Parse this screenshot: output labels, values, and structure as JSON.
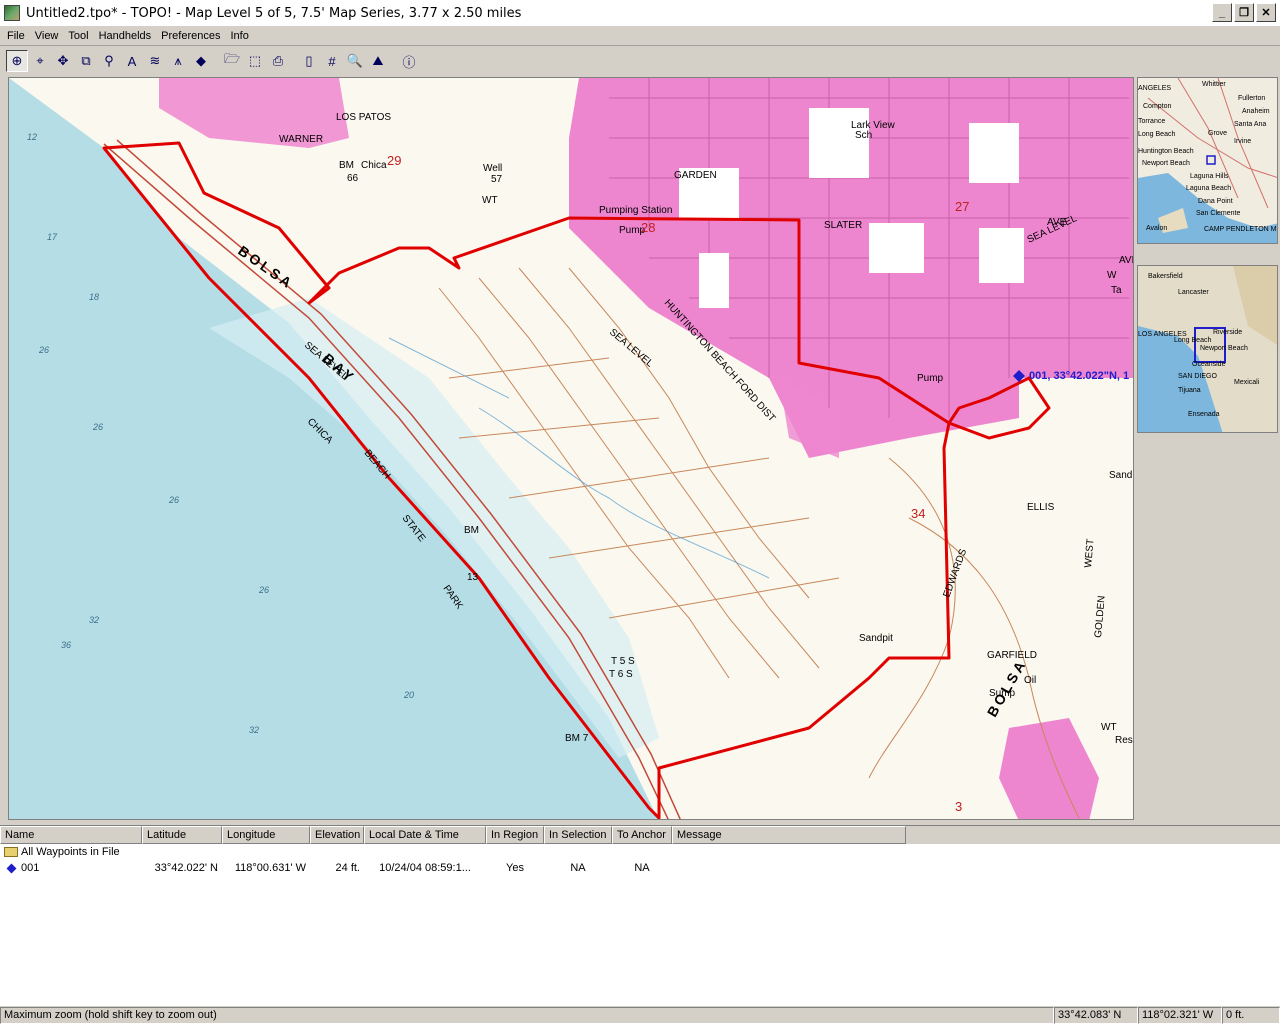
{
  "window": {
    "title": "Untitled2.tpo* - TOPO! - Map Level 5 of 5, 7.5' Map Series, 3.77 x 2.50 miles",
    "buttons": [
      "_",
      "❐",
      "✕"
    ]
  },
  "menu": [
    "File",
    "View",
    "Tool",
    "Handhelds",
    "Preferences",
    "Info"
  ],
  "toolbar": {
    "tools": [
      {
        "name": "zoom-tool-icon",
        "glyph": "⊕",
        "active": true
      },
      {
        "name": "center-tool-icon",
        "glyph": "⌖",
        "active": false
      },
      {
        "name": "pan-tool-icon",
        "glyph": "✥",
        "active": false
      },
      {
        "name": "copy-map-icon",
        "glyph": "⧉",
        "active": false
      },
      {
        "name": "pushpin-tool-icon",
        "glyph": "⚲",
        "active": false
      },
      {
        "name": "text-tool-icon",
        "glyph": "A",
        "active": false
      },
      {
        "name": "route-tool-icon",
        "glyph": "≋",
        "active": false
      },
      {
        "name": "north-arrow-icon",
        "glyph": "⩚",
        "active": false
      },
      {
        "name": "waypoint-tool-icon",
        "glyph": "◆",
        "active": false
      },
      {
        "name": "open-file-icon",
        "glyph": "🗁",
        "active": false
      },
      {
        "name": "select-area-icon",
        "glyph": "⬚",
        "active": false
      },
      {
        "name": "print-icon",
        "glyph": "⎙",
        "active": false
      },
      {
        "name": "handheld-icon",
        "glyph": "▯",
        "active": false
      },
      {
        "name": "grid-icon",
        "glyph": "#",
        "active": false
      },
      {
        "name": "search-icon",
        "glyph": "🔍",
        "active": false
      },
      {
        "name": "elevation-profile-icon",
        "glyph": "⛰",
        "active": false
      },
      {
        "name": "info-icon",
        "glyph": "ⓘ",
        "active": false
      }
    ]
  },
  "map": {
    "labels": [
      "Lark View",
      "Sch",
      "Pumping Station",
      "Pump",
      "Pump",
      "SLATER",
      "AVE",
      "AVE",
      "GARDEN",
      "WARNER",
      "LOS PATOS",
      "Chica",
      "BM",
      "66",
      "Well",
      "57",
      "WT",
      "29",
      "28",
      "27",
      "34",
      "3",
      "BOLSA",
      "BAY",
      "BOLSA",
      "CHICA",
      "BEACH",
      "STATE",
      "PARK",
      "HUNTINGTON BEACH FORD DIST",
      "SEA LEVEL",
      "SEA LEVEL",
      "SEA LEVEL",
      "EDWARDS",
      "ELLIS",
      "GARFIELD",
      "GOLDEN",
      "WEST",
      "Sandpit",
      "Oil",
      "Sump",
      "BM",
      "13",
      "BM 7",
      "T 5 S",
      "T 6 S",
      "12",
      "17",
      "18",
      "26",
      "26",
      "26",
      "26",
      "32",
      "32",
      "36",
      "20",
      "Sand",
      "Res",
      "WT",
      "Ta",
      "W"
    ],
    "waypoint_label": "001, 33°42.022\"N, 1"
  },
  "overview_top": {
    "labels": [
      "ANGELES",
      "Compton",
      "Torrance",
      "Long Beach",
      "Huntington Beach",
      "Newport Beach",
      "Laguna Hills",
      "Laguna Beach",
      "Dana Point",
      "San Clemente",
      "Fullerton",
      "Anaheim",
      "Santa Ana",
      "Grove",
      "Irvine",
      "Avalon",
      "CAMP PENDLETON M",
      "Whittier"
    ]
  },
  "overview_bottom": {
    "labels": [
      "Bakersfield",
      "Lancaster",
      "LOS ANGELES",
      "Long Beach",
      "Riverside",
      "Newport Beach",
      "SAN DIEGO",
      "Oceanside",
      "Tijuana",
      "Ensenada",
      "Mexicali"
    ]
  },
  "grid": {
    "columns": [
      "Name",
      "Latitude",
      "Longitude",
      "Elevation",
      "Local Date & Time",
      "In Region",
      "In Selection",
      "To Anchor",
      "Message"
    ],
    "folder": "All Waypoints in File",
    "rows": [
      {
        "name": "001",
        "latitude": "33°42.022' N",
        "longitude": "118°00.631' W",
        "elevation": "24 ft.",
        "datetime": "10/24/04 08:59:1...",
        "in_region": "Yes",
        "in_selection": "NA",
        "to_anchor": "NA",
        "message": ""
      }
    ]
  },
  "status": {
    "message": "Maximum zoom (hold shift key to zoom out)",
    "latitude": "33°42.083' N",
    "longitude": "118°02.321' W",
    "elevation": "0 ft."
  },
  "colors": {
    "ocean": "#b5dde6",
    "urban": "#ee86cf",
    "route": "#e00000",
    "contour": "#c8875a",
    "waypoint": "#1e1ecc"
  }
}
